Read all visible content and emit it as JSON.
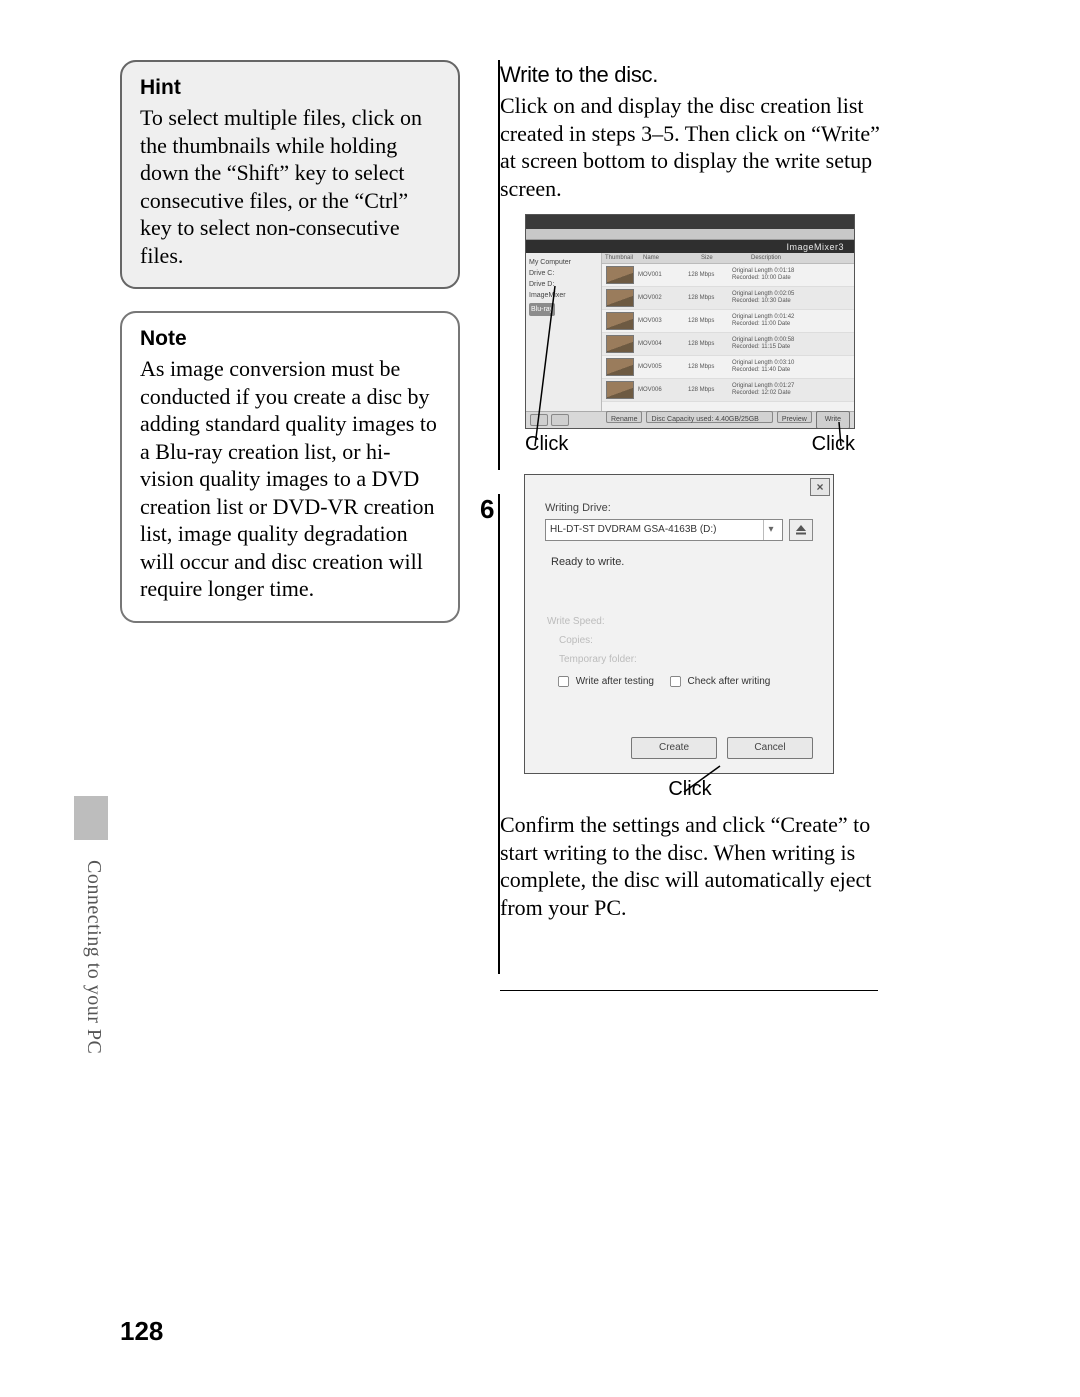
{
  "page_number": "128",
  "section_label": "Connecting to your PC",
  "hint": {
    "title": "Hint",
    "body": "To select multiple files, click on the thumbnails while holding down the “Shift” key to select consecutive files, or the “Ctrl” key to select non-consecutive files."
  },
  "note": {
    "title": "Note",
    "body": "As image conversion must be conducted if you create a disc by adding standard quality images to a Blu-ray creation list, or hi-vision quality images to a DVD creation list or DVD-VR creation list, image quality degradation will occur and disc creation will require longer time."
  },
  "right": {
    "heading": "Write to the disc.",
    "intro": "Click on and display the disc creation list created in steps 3–5. Then click on “Write” at screen bottom to display the write setup screen.",
    "click_left": "Click",
    "click_right": "Click",
    "step_number": "6",
    "confirm": "Confirm the settings and click “Create” to start writing to the disc. When writing is complete, the disc will automatically eject from your PC.",
    "click_center": "Click"
  },
  "app_screenshot": {
    "brand": "ImageMixer3",
    "columns": {
      "thumb": "Thumbnail",
      "name": "Name",
      "size": "Size",
      "info": "Description"
    },
    "tree": [
      "My Computer",
      "Drive C:",
      "Drive D:",
      "ImageMixer",
      "Blu-ray"
    ],
    "tree_selected": "Blu-ray",
    "rows": [
      {
        "name": "MOV001",
        "size": "128 Mbps",
        "info": "Original Length 0:01:18\nRecorded: 10:00  Date"
      },
      {
        "name": "MOV002",
        "size": "128 Mbps",
        "info": "Original Length 0:02:05\nRecorded: 10:30  Date"
      },
      {
        "name": "MOV003",
        "size": "128 Mbps",
        "info": "Original Length 0:01:42\nRecorded: 11:00  Date"
      },
      {
        "name": "MOV004",
        "size": "128 Mbps",
        "info": "Original Length 0:00:58\nRecorded: 11:15  Date"
      },
      {
        "name": "MOV005",
        "size": "128 Mbps",
        "info": "Original Length 0:03:10\nRecorded: 11:40  Date"
      },
      {
        "name": "MOV006",
        "size": "128 Mbps",
        "info": "Original Length 0:01:27\nRecorded: 12:02  Date"
      }
    ],
    "status_buttons": {
      "rename": "Rename",
      "capacity": "Disc Capacity used: 4.40GB/25GB",
      "preview": "Preview",
      "write": "Write"
    }
  },
  "dialog": {
    "close": "×",
    "drive_label": "Writing Drive:",
    "drive_value": "HL-DT-ST DVDRAM GSA-4163B (D:)",
    "ready": "Ready to write.",
    "disabled1": "Write Speed:",
    "disabled2": "Copies:",
    "disabled3": "Temporary folder:",
    "chk1": "Write after testing",
    "chk2": "Check after writing",
    "create": "Create",
    "cancel": "Cancel"
  }
}
